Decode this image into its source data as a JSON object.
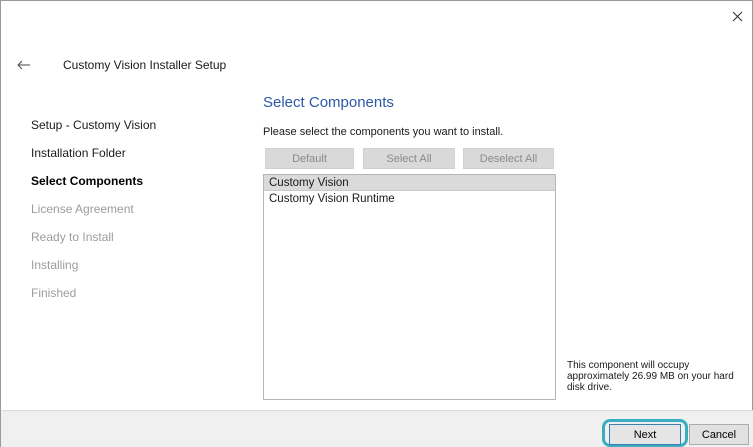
{
  "window": {
    "close_icon": "close-icon",
    "back_icon": "back-arrow-icon",
    "title": "Customy Vision Installer Setup"
  },
  "steps": [
    {
      "label": "Setup - Customy Vision",
      "state": "done"
    },
    {
      "label": "Installation Folder",
      "state": "done"
    },
    {
      "label": "Select Components",
      "state": "current"
    },
    {
      "label": "License Agreement",
      "state": "pending"
    },
    {
      "label": "Ready to Install",
      "state": "pending"
    },
    {
      "label": "Installing",
      "state": "pending"
    },
    {
      "label": "Finished",
      "state": "pending"
    }
  ],
  "main": {
    "title": "Select Components",
    "instructions": "Please select the components you want to install.",
    "buttons": {
      "default_label": "Default",
      "select_all_label": "Select All",
      "deselect_all_label": "Deselect All"
    },
    "components": [
      {
        "label": "Customy Vision",
        "selected": true
      },
      {
        "label": "Customy Vision Runtime",
        "selected": false
      }
    ],
    "info": "This component will occupy approximately 26.99 MB on your hard disk drive."
  },
  "footer": {
    "next_label": "Next",
    "cancel_label": "Cancel"
  },
  "colors": {
    "title_blue": "#2b59a6",
    "focus_ring": "#3aaec0",
    "pending_step": "#9c9c9c"
  }
}
